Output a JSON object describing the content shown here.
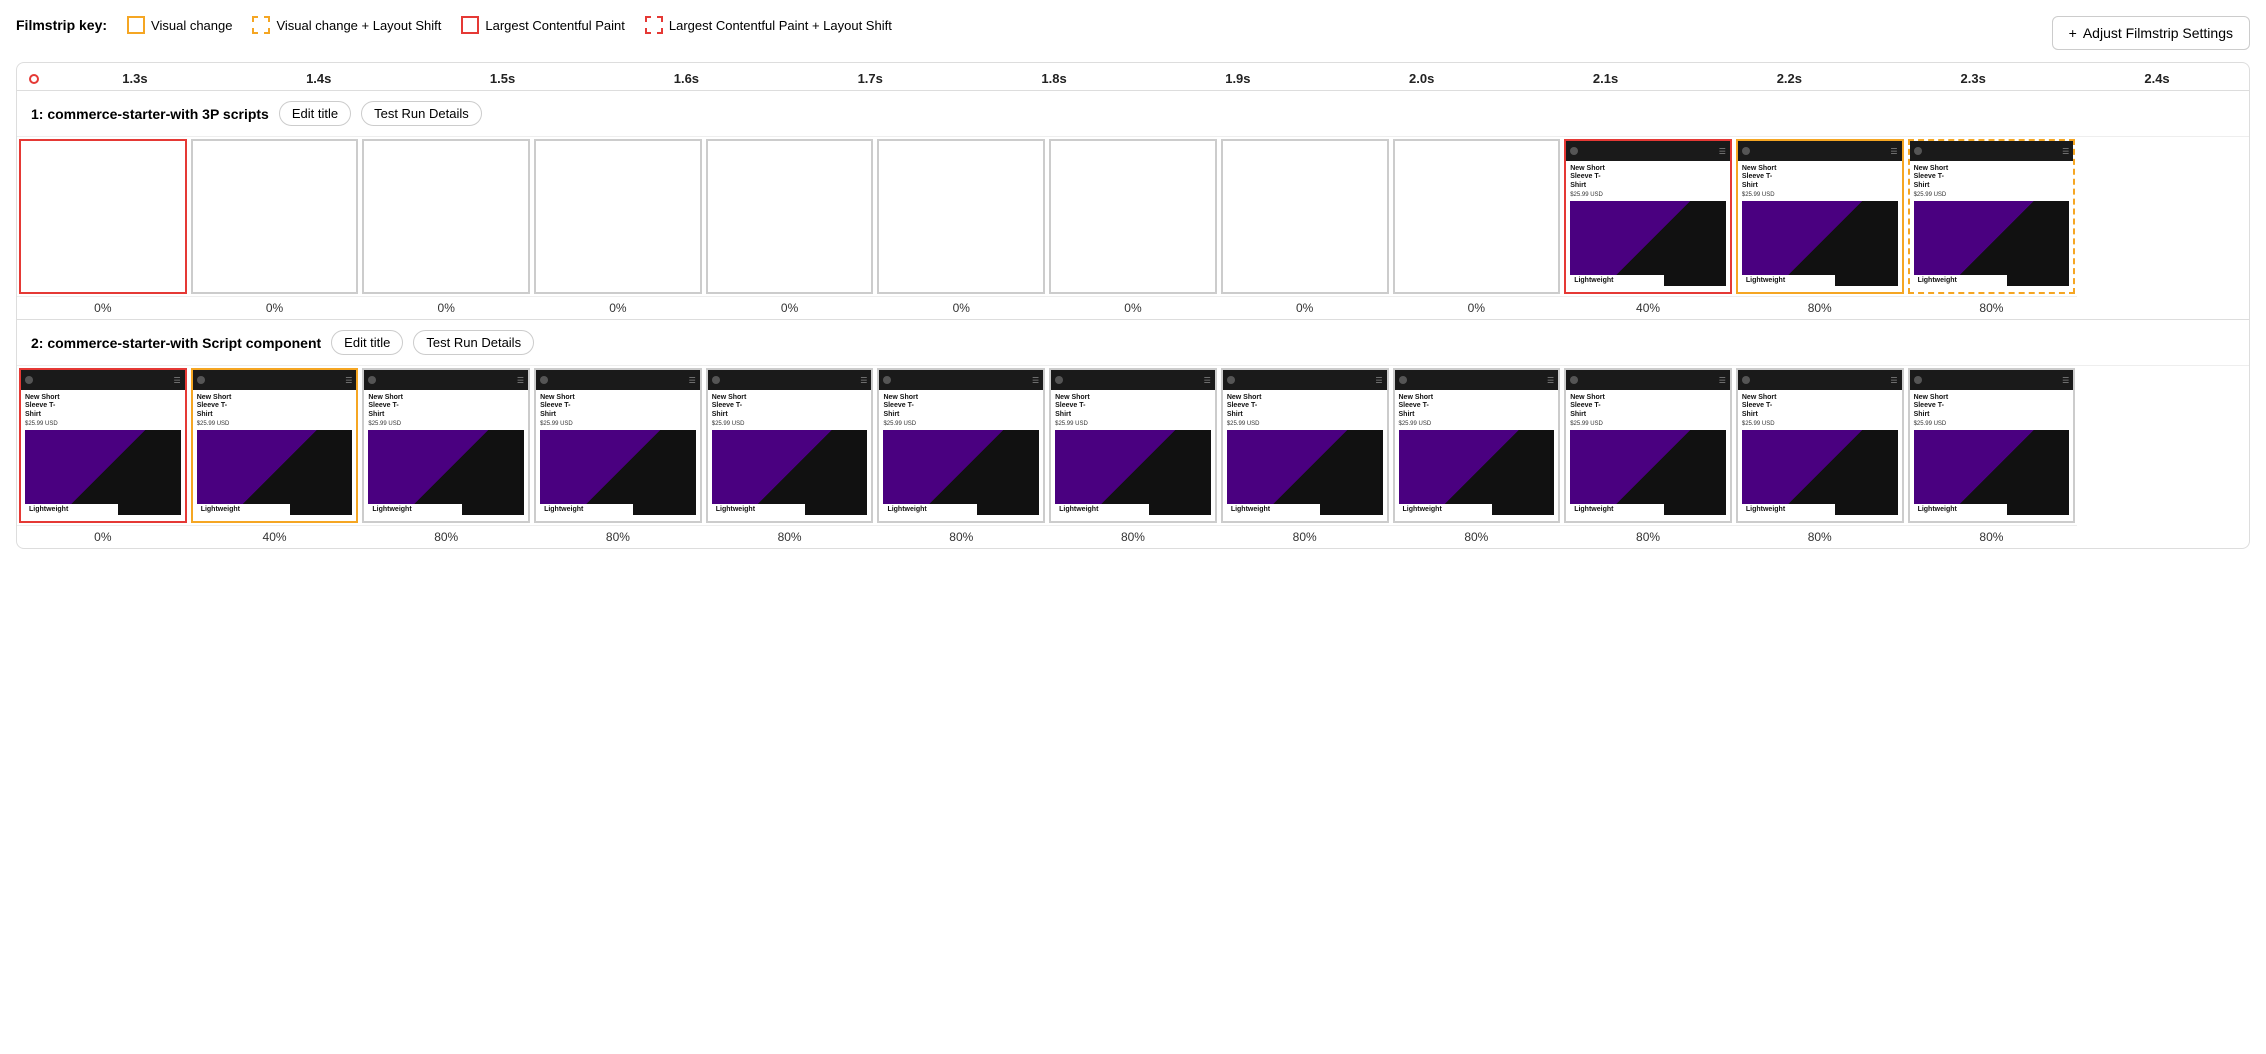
{
  "key": {
    "label": "Filmstrip key:",
    "items": [
      {
        "id": "visual-change",
        "label": "Visual change",
        "borderStyle": "solid",
        "borderColor": "#f5a623"
      },
      {
        "id": "visual-change-layout-shift",
        "label": "Visual change + Layout Shift",
        "borderStyle": "dashed",
        "borderColor": "#f5a623"
      },
      {
        "id": "lcp",
        "label": "Largest Contentful Paint",
        "borderStyle": "solid",
        "borderColor": "#e53935"
      },
      {
        "id": "lcp-layout-shift",
        "label": "Largest Contentful Paint + Layout Shift",
        "borderStyle": "dashed",
        "borderColor": "#e53935"
      }
    ]
  },
  "adjustButton": {
    "label": "Adjust Filmstrip Settings",
    "icon": "+"
  },
  "timeline": {
    "ticks": [
      "1.3s",
      "1.4s",
      "1.5s",
      "1.6s",
      "1.7s",
      "1.8s",
      "1.9s",
      "2.0s",
      "2.1s",
      "2.2s",
      "2.3s",
      "2.4s"
    ]
  },
  "rows": [
    {
      "id": "row1",
      "title": "1: commerce-starter-with 3P scripts",
      "editLabel": "Edit title",
      "detailsLabel": "Test Run Details",
      "frames": [
        {
          "borderType": "red",
          "empty": true
        },
        {
          "borderType": "gray",
          "empty": true
        },
        {
          "borderType": "gray",
          "empty": true
        },
        {
          "borderType": "gray",
          "empty": true
        },
        {
          "borderType": "gray",
          "empty": true
        },
        {
          "borderType": "gray",
          "empty": true
        },
        {
          "borderType": "gray",
          "empty": true
        },
        {
          "borderType": "gray",
          "empty": true
        },
        {
          "borderType": "gray",
          "empty": true
        },
        {
          "borderType": "red",
          "empty": false
        },
        {
          "borderType": "yellow",
          "empty": false
        },
        {
          "borderType": "yellow-dashed",
          "empty": false
        }
      ],
      "percents": [
        "0%",
        "0%",
        "0%",
        "0%",
        "0%",
        "0%",
        "0%",
        "0%",
        "0%",
        "40%",
        "80%",
        "80%"
      ]
    },
    {
      "id": "row2",
      "title": "2: commerce-starter-with Script component",
      "editLabel": "Edit title",
      "detailsLabel": "Test Run Details",
      "frames": [
        {
          "borderType": "red",
          "empty": false
        },
        {
          "borderType": "yellow",
          "empty": false
        },
        {
          "borderType": "gray",
          "empty": false
        },
        {
          "borderType": "gray",
          "empty": false
        },
        {
          "borderType": "gray",
          "empty": false
        },
        {
          "borderType": "gray",
          "empty": false
        },
        {
          "borderType": "gray",
          "empty": false
        },
        {
          "borderType": "gray",
          "empty": false
        },
        {
          "borderType": "gray",
          "empty": false
        },
        {
          "borderType": "gray",
          "empty": false
        },
        {
          "borderType": "gray",
          "empty": false
        },
        {
          "borderType": "gray",
          "empty": false
        }
      ],
      "percents": [
        "0%",
        "40%",
        "80%",
        "80%",
        "80%",
        "80%",
        "80%",
        "80%",
        "80%",
        "80%",
        "80%",
        "80%"
      ]
    }
  ],
  "product": {
    "name": "New Short Sleeve T-Shirt",
    "price": "$25.99 USD",
    "badge": "Lightweight"
  }
}
